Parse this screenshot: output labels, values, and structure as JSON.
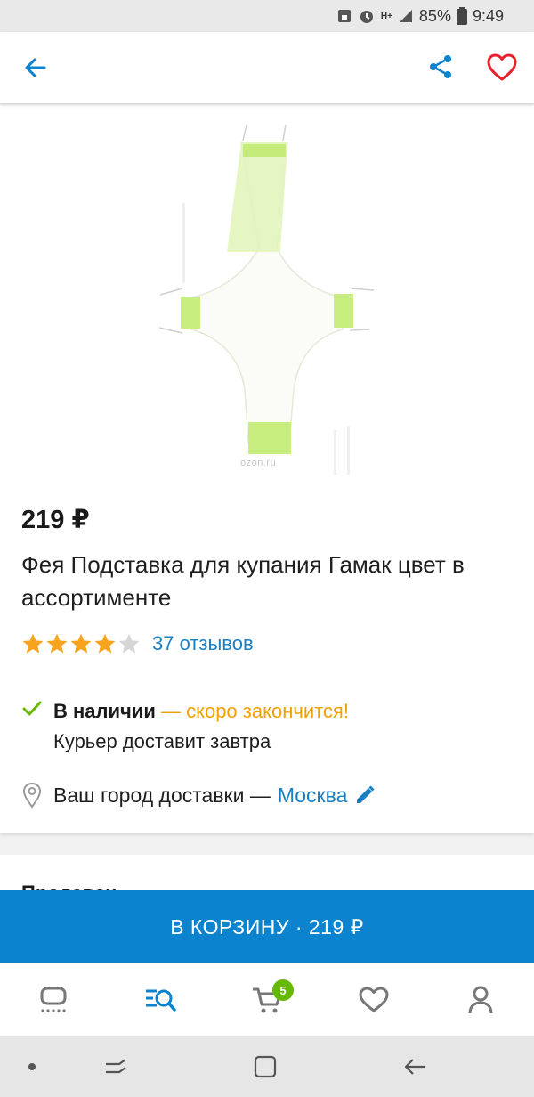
{
  "status_bar": {
    "battery": "85%",
    "time": "9:49",
    "network": "H+"
  },
  "product": {
    "image_watermark": "ozon.ru",
    "price": "219 ₽",
    "title": "Фея Подставка для купания Гамак цвет в ассортименте",
    "rating_stars": 4,
    "rating_max": 5,
    "reviews_label": "37 отзывов",
    "stock_status": "В наличии",
    "stock_warning": " — скоро закончится!",
    "delivery_note": "Курьер доставит завтра",
    "city_prefix": "Ваш город доставки —",
    "city_name": "Москва"
  },
  "seller_section": {
    "title": "Продавец"
  },
  "cart_button": {
    "label": "В КОРЗИНУ · 219 ₽"
  },
  "bottom_nav": {
    "cart_badge": "5"
  },
  "colors": {
    "accent": "#0b83cf",
    "link": "#1a7fc3",
    "star": "#f7a31d",
    "warning": "#f1a100",
    "favorite": "#e8222d",
    "badge": "#67b900"
  },
  "icons": [
    "back-arrow-icon",
    "share-icon",
    "heart-icon",
    "star-icon",
    "check-icon",
    "location-pin-icon",
    "pencil-icon",
    "home-icon",
    "search-catalog-icon",
    "cart-icon",
    "favorites-icon",
    "profile-icon"
  ]
}
